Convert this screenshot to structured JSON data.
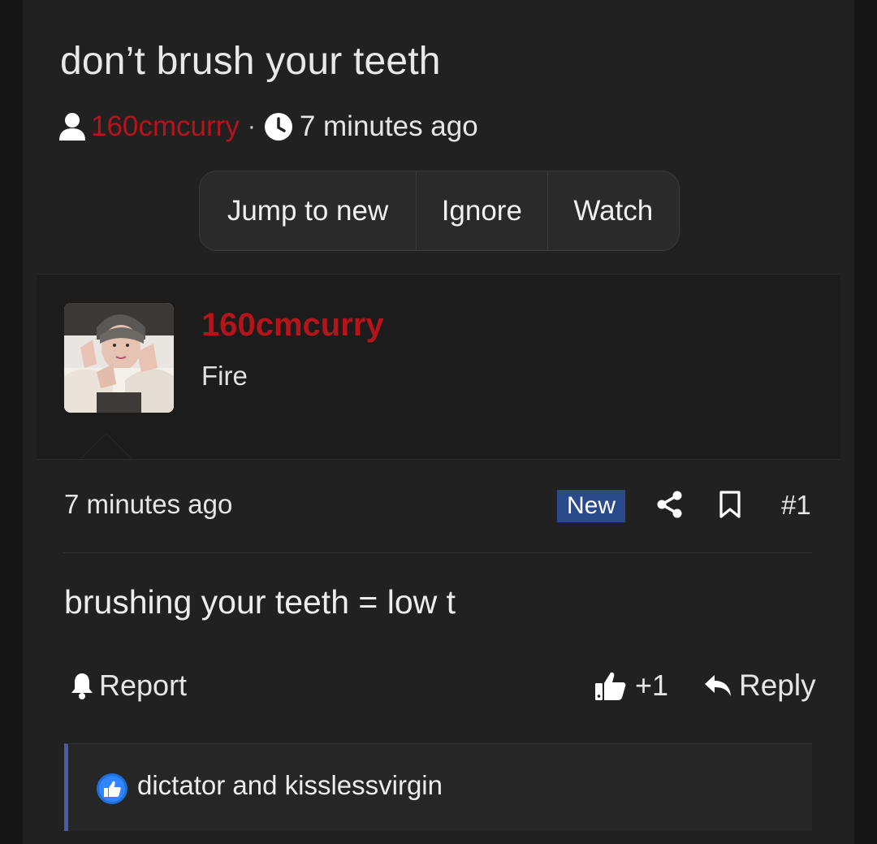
{
  "thread": {
    "title": "don’t brush your teeth",
    "author": "160cmcurry",
    "separator": "·",
    "time": "7 minutes ago"
  },
  "actions": {
    "jump_label": "Jump to new",
    "ignore_label": "Ignore",
    "watch_label": "Watch"
  },
  "post": {
    "username": "160cmcurry",
    "user_title": "Fire",
    "time": "7 minutes ago",
    "badge": "New",
    "number": "#1",
    "body": "brushing your teeth = low t",
    "report_label": "Report",
    "like_count": "+1",
    "reply_label": "Reply",
    "reactions_text": "dictator and kisslessvirgin"
  },
  "colors": {
    "accent_red": "#b5141b",
    "badge_blue": "#2a4a8b",
    "reaction_border": "#4a5aa8"
  },
  "icons": [
    "user-icon",
    "clock-icon",
    "share-icon",
    "bookmark-icon",
    "bell-icon",
    "thumbs-up-icon",
    "reply-icon",
    "like-reaction-icon"
  ]
}
